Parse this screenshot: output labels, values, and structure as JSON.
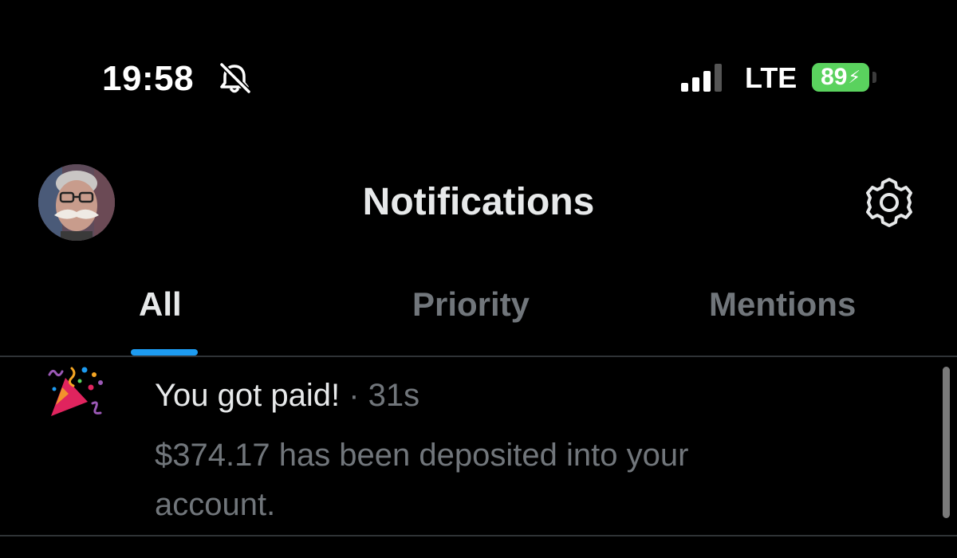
{
  "status_bar": {
    "time": "19:58",
    "network": "LTE",
    "battery": "89",
    "icons": [
      "bell-slash-icon",
      "signal-bars-icon",
      "battery-charging-icon"
    ]
  },
  "header": {
    "title": "Notifications",
    "icons": [
      "avatar",
      "gear-icon"
    ]
  },
  "tabs": [
    {
      "label": "All",
      "active": true
    },
    {
      "label": "Priority",
      "active": false
    },
    {
      "label": "Mentions",
      "active": false
    }
  ],
  "notifications": [
    {
      "icon": "party-popper-icon",
      "title": "You got paid!",
      "separator": "·",
      "time": "31s",
      "body": "$374.17 has been deposited into your account."
    }
  ],
  "colors": {
    "background": "#000000",
    "primary_text": "#e7e9ea",
    "secondary_text": "#71767b",
    "accent": "#1d9bf0",
    "battery": "#5ad25e",
    "divider": "#2f3336"
  }
}
